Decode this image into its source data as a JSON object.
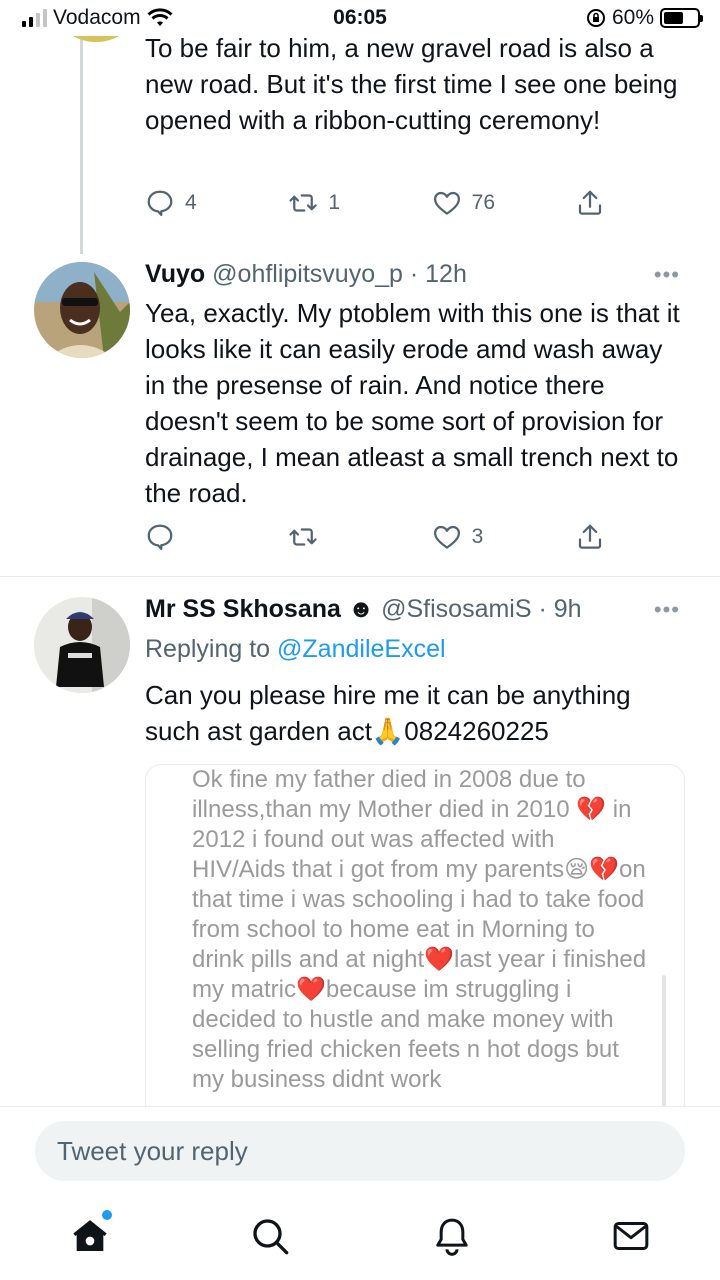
{
  "status_bar": {
    "carrier": "Vodacom",
    "time": "06:05",
    "battery": "60%",
    "battery_level": 0.6
  },
  "tweets": [
    {
      "text": "To be fair to him, a new gravel road is also a new road. But it's the first time I see one being opened with a ribbon-cutting ceremony!",
      "replies": "4",
      "retweets": "1",
      "likes": "76"
    },
    {
      "name": "Vuyo",
      "handle": "@ohflipitsvuyo_p",
      "time": "· 12h",
      "text": "Yea, exactly. My ptoblem with this one is that it looks like it can easily erode amd wash away in the presense of rain. And notice there doesn't seem to be some sort of provision for drainage, I mean atleast a small trench next to the road.",
      "replies": "",
      "retweets": "",
      "likes": "3"
    },
    {
      "name": "Mr SS Skhosana",
      "emoji": "☻",
      "handle": "@SfisosamiS",
      "time": "· 9h",
      "replying_prefix": "Replying to",
      "replying_to": "@ZandileExcel",
      "text": "Can you please hire me it can be anything such ast garden act🙏0824260225",
      "image_text": "Ok fine my father died in 2008 due to illness,than my Mother died in 2010 💔 in 2012 i found out was affected with HIV/Aids that i got from my parents😪💔on that time i was schooling i had to take food from school to home eat in Morning to drink pills and at night❤️last year i finished my matric❤️because im struggling i decided to hustle and make money with selling fried chicken feets n hot dogs but my business didnt work"
    }
  ],
  "reply_bar": {
    "placeholder": "Tweet your reply"
  },
  "nav": {
    "items": [
      "home-icon",
      "search-icon",
      "notifications-icon",
      "messages-icon"
    ]
  }
}
